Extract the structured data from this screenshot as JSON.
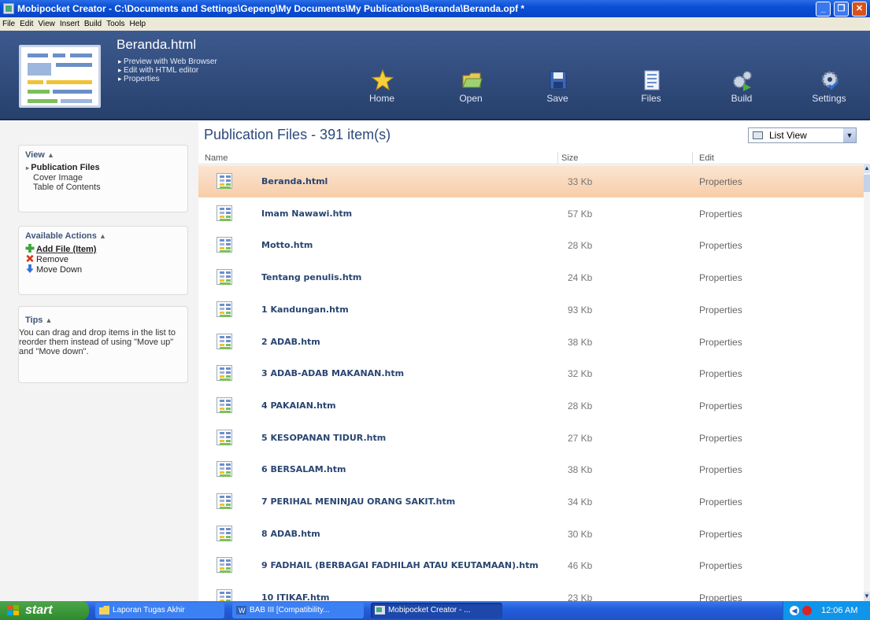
{
  "window": {
    "title": "Mobipocket Creator - C:\\Documents and Settings\\Gepeng\\My Documents\\My Publications\\Beranda\\Beranda.opf *",
    "controls": {
      "minimize": "_",
      "restore": "❐",
      "close": "✕"
    }
  },
  "menu": [
    "File",
    "Edit",
    "View",
    "Insert",
    "Build",
    "Tools",
    "Help"
  ],
  "document": {
    "title": "Beranda.html",
    "actions": [
      "Preview with Web Browser",
      "Edit with HTML editor",
      "Properties"
    ]
  },
  "toolbar": [
    {
      "label": "Home",
      "icon": "star-icon"
    },
    {
      "label": "Open",
      "icon": "folder-icon"
    },
    {
      "label": "Save",
      "icon": "floppy-icon"
    },
    {
      "label": "Files",
      "icon": "files-icon"
    },
    {
      "label": "Build",
      "icon": "build-icon"
    },
    {
      "label": "Settings",
      "icon": "settings-icon"
    }
  ],
  "sidebar": {
    "view": {
      "title": "View",
      "collapse": "▲",
      "items": [
        {
          "label": "Publication Files",
          "selected": true
        },
        {
          "label": "Cover Image",
          "selected": false
        },
        {
          "label": "Table of Contents",
          "selected": false
        }
      ]
    },
    "actions": {
      "title": "Available Actions",
      "collapse": "▲",
      "items": [
        {
          "label": "Add File (Item)",
          "icon": "plus-icon",
          "color": "#3aa63a"
        },
        {
          "label": "Remove",
          "icon": "remove-icon",
          "color": "#d8381e"
        },
        {
          "label": "Move Down",
          "icon": "arrow-down-icon",
          "color": "#2f6fd6"
        }
      ]
    },
    "tips": {
      "title": "Tips",
      "collapse": "▲",
      "text": "You can drag and drop items in the list to reorder them instead of using \"Move up\" and \"Move down\"."
    }
  },
  "main": {
    "title": "Publication Files - 391 item(s)",
    "view_select": "List View",
    "columns": {
      "name": "Name",
      "size": "Size",
      "edit": "Edit"
    },
    "files": [
      {
        "name": "Beranda.html",
        "size": "33 Kb",
        "edit": "Properties",
        "selected": true
      },
      {
        "name": "Imam Nawawi.htm",
        "size": "57 Kb",
        "edit": "Properties"
      },
      {
        "name": "Motto.htm",
        "size": "28 Kb",
        "edit": "Properties"
      },
      {
        "name": "Tentang penulis.htm",
        "size": "24 Kb",
        "edit": "Properties"
      },
      {
        "name": "1 Kandungan.htm",
        "size": "93 Kb",
        "edit": "Properties"
      },
      {
        "name": "2 ADAB.htm",
        "size": "38 Kb",
        "edit": "Properties"
      },
      {
        "name": "3 ADAB-ADAB MAKANAN.htm",
        "size": "32 Kb",
        "edit": "Properties"
      },
      {
        "name": "4 PAKAIAN.htm",
        "size": "28 Kb",
        "edit": "Properties"
      },
      {
        "name": "5 KESOPANAN TIDUR.htm",
        "size": "27 Kb",
        "edit": "Properties"
      },
      {
        "name": "6 BERSALAM.htm",
        "size": "38 Kb",
        "edit": "Properties"
      },
      {
        "name": "7 PERIHAL MENINJAU ORANG SAKIT.htm",
        "size": "34 Kb",
        "edit": "Properties"
      },
      {
        "name": "8 ADAB.htm",
        "size": "30 Kb",
        "edit": "Properties"
      },
      {
        "name": "9 FADHAIL (BERBAGAI FADHILAH ATAU KEUTAMAAN).htm",
        "size": "46 Kb",
        "edit": "Properties"
      },
      {
        "name": "10 ITIKAF.htm",
        "size": "23 Kb",
        "edit": "Properties"
      }
    ]
  },
  "taskbar": {
    "start": "start",
    "tasks": [
      {
        "label": "Laporan Tugas Akhir",
        "icon": "folder-icon"
      },
      {
        "label": "BAB III [Compatibility...",
        "icon": "word-icon"
      },
      {
        "label": "Mobipocket Creator - ...",
        "icon": "app-icon",
        "active": true
      }
    ],
    "clock": "12:06 AM"
  },
  "colors": {
    "accent": "#2c4a7c",
    "selected_row": "#f7cda8",
    "banner": "#2f4a7b"
  }
}
